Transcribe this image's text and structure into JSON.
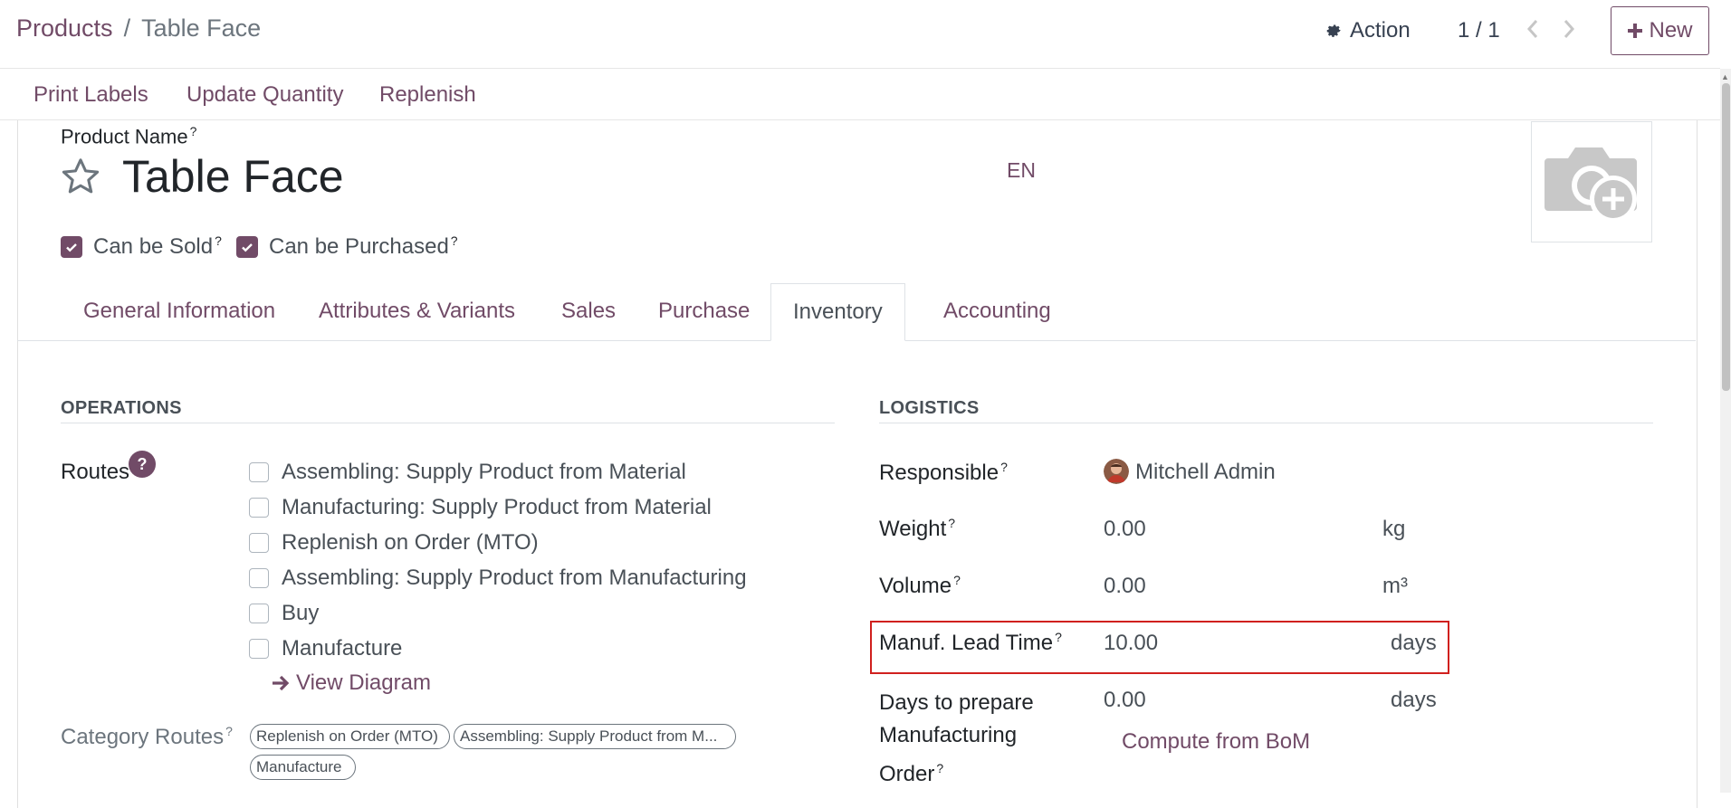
{
  "breadcrumb": {
    "parent": "Products",
    "separator": "/",
    "current": "Table Face"
  },
  "header": {
    "action_label": "Action",
    "pager": "1 / 1",
    "new_label": "New"
  },
  "toolbar": {
    "print_labels": "Print Labels",
    "update_quantity": "Update Quantity",
    "replenish": "Replenish"
  },
  "product": {
    "name_label": "Product Name",
    "name": "Table Face",
    "lang": "EN",
    "can_be_sold_label": "Can be Sold",
    "can_be_sold": true,
    "can_be_purchased_label": "Can be Purchased",
    "can_be_purchased": true,
    "help_mark": "?"
  },
  "tabs": [
    {
      "label": "General Information",
      "active": false
    },
    {
      "label": "Attributes & Variants",
      "active": false
    },
    {
      "label": "Sales",
      "active": false
    },
    {
      "label": "Purchase",
      "active": false
    },
    {
      "label": "Inventory",
      "active": true
    },
    {
      "label": "Accounting",
      "active": false
    }
  ],
  "operations": {
    "title": "OPERATIONS",
    "routes_label": "Routes",
    "routes_help": "?",
    "routes": [
      {
        "label": "Assembling: Supply Product from Material",
        "checked": false
      },
      {
        "label": "Manufacturing: Supply Product from Material",
        "checked": false
      },
      {
        "label": "Replenish on Order (MTO)",
        "checked": false
      },
      {
        "label": "Assembling: Supply Product from Manufacturing",
        "checked": false
      },
      {
        "label": "Buy",
        "checked": false
      },
      {
        "label": "Manufacture",
        "checked": false
      }
    ],
    "view_diagram": "View Diagram",
    "category_routes_label": "Category Routes",
    "category_routes": [
      "Replenish on Order (MTO)",
      "Assembling: Supply Product from M...",
      "Manufacture"
    ]
  },
  "logistics": {
    "title": "LOGISTICS",
    "responsible_label": "Responsible",
    "responsible": "Mitchell Admin",
    "weight_label": "Weight",
    "weight": "0.00",
    "weight_unit": "kg",
    "volume_label": "Volume",
    "volume": "0.00",
    "volume_unit": "m³",
    "manuf_lead_time_label": "Manuf. Lead Time",
    "manuf_lead_time": "10.00",
    "manuf_lead_time_unit": "days",
    "days_prepare_label_1": "Days to prepare",
    "days_prepare_label_2": "Manufacturing",
    "days_prepare_label_3": "Order",
    "days_prepare": "0.00",
    "days_prepare_unit": "days",
    "compute_from_bom": "Compute from BoM"
  },
  "colors": {
    "accent": "#714B67",
    "highlight": "#d0201e"
  }
}
